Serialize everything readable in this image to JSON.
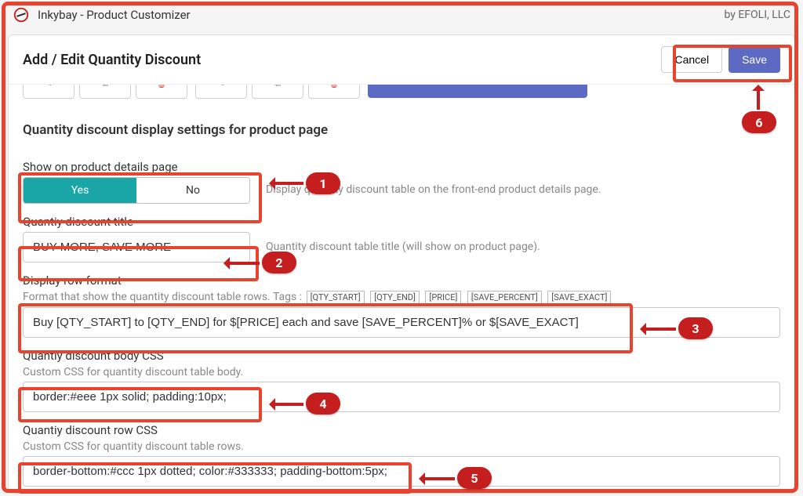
{
  "header": {
    "app_title": "Inkybay - Product Customizer",
    "by_label": "by EFOLI, LLC"
  },
  "panel": {
    "title": "Add / Edit Quantity Discount",
    "cancel_label": "Cancel",
    "save_label": "Save"
  },
  "section": {
    "title": "Quantity discount display settings for product page"
  },
  "show_on_page": {
    "label": "Show on product details page",
    "yes": "Yes",
    "no": "No",
    "help": "Display quantity discount table on the front-end product details page."
  },
  "title_field": {
    "label": "Quantiy discount title",
    "value": "BUY MORE, SAVE MORE",
    "help": "Quantity discount table title (will show on product page)."
  },
  "row_format": {
    "label": "Display row format",
    "help_prefix": "Format that show the quantity discount table rows. Tags :",
    "tags": [
      "[QTY_START]",
      "[QTY_END]",
      "[PRICE]",
      "[SAVE_PERCENT]",
      "[SAVE_EXACT]"
    ],
    "value": "Buy [QTY_START] to [QTY_END] for $[PRICE] each and save [SAVE_PERCENT]% or $[SAVE_EXACT]"
  },
  "body_css": {
    "label": "Quantiy discount body CSS",
    "help": "Custom CSS for quantity discount table body.",
    "value": "border:#eee 1px solid; padding:10px;"
  },
  "row_css": {
    "label": "Quantiy discount row CSS",
    "help": "Custom CSS for quantity discount table rows.",
    "value": "border-bottom:#ccc 1px dotted; color:#333333; padding-bottom:5px;"
  },
  "annotations": {
    "b1": "1",
    "b2": "2",
    "b3": "3",
    "b4": "4",
    "b5": "5",
    "b6": "6"
  }
}
